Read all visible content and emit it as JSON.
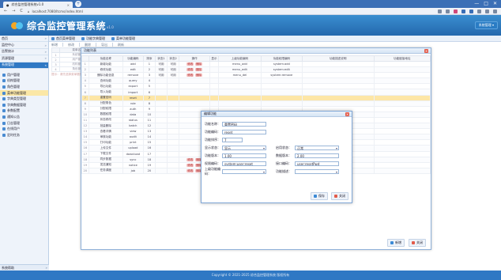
{
  "browser": {
    "tab_title": "综合监控管理系统v1.0",
    "url": "localhost:7080/ltcms/index.html",
    "buttons": [
      "←",
      "→",
      "C",
      "⌂"
    ],
    "window_controls": [
      "—",
      "□",
      "✕"
    ]
  },
  "header": {
    "app_title": "综合监控管理系统",
    "version": "v1.0",
    "user_button": "系统管理 ▾"
  },
  "sidebar": {
    "items": [
      {
        "label": "首页",
        "active": false
      },
      {
        "label": "监控中心",
        "active": false
      },
      {
        "label": "告警统计",
        "active": false
      },
      {
        "label": "资源管理",
        "active": false
      },
      {
        "label": "系统管理",
        "active": true
      }
    ],
    "subitems": [
      {
        "label": "用户管理",
        "selected": false
      },
      {
        "label": "机构管理",
        "selected": false
      },
      {
        "label": "角色管理",
        "selected": false
      },
      {
        "label": "菜单功能管理",
        "selected": true
      },
      {
        "label": "字典类型管理",
        "selected": false
      },
      {
        "label": "字典数据管理",
        "selected": false
      },
      {
        "label": "参数配置",
        "selected": false
      },
      {
        "label": "通知公告",
        "selected": false
      },
      {
        "label": "日志管理",
        "selected": false
      },
      {
        "label": "在线用户",
        "selected": false
      },
      {
        "label": "定时任务",
        "selected": false
      }
    ],
    "bottom_label": "系统帮助"
  },
  "breadcrumbs": [
    "首页菜单管理",
    "功能字典管理",
    "菜单功能管理"
  ],
  "toolbar": [
    "新增",
    "修改",
    "删除",
    "导出",
    "刷新"
  ],
  "bg_table": {
    "headers": [
      "",
      "菜单名称",
      "排序",
      "类型",
      "权限",
      "状态",
      "操作"
    ],
    "rows": [
      [
        "1",
        "系统管理",
        "1",
        "目录",
        "",
        "正常",
        "修改"
      ],
      [
        "2",
        "用户管理",
        "1",
        "菜单",
        "system:user",
        "正常",
        "修改"
      ],
      [
        "3",
        "机构管理",
        "2",
        "菜单",
        "system:dept",
        "正常",
        "修改"
      ],
      [
        "4",
        "角色管理",
        "3",
        "菜单",
        "system:role",
        "正常",
        "修改"
      ]
    ],
    "hint": "提示：请先选择菜单数据，再点击功能字典按钮进行操作"
  },
  "window": {
    "title": "功能列表",
    "headers": [
      "",
      "功能名称",
      "功能编码",
      "排序",
      "状态1",
      "状态2",
      "操作",
      "显示",
      "上级功能编码",
      "功能权限编码",
      "功能描述说明",
      "功能链接地址"
    ],
    "rows": [
      {
        "n": "1",
        "name": "新增功能",
        "code": "add",
        "sort": "1",
        "s1": "可用",
        "s2": "可用",
        "ops": [
          "修改",
          "删除"
        ],
        "pcode": "menu_add",
        "perm": "system:add",
        "hl": false
      },
      {
        "n": "2",
        "name": "修改功能",
        "code": "edit",
        "sort": "2",
        "s1": "可用",
        "s2": "可用",
        "ops": [
          "修改",
          "删除"
        ],
        "pcode": "menu_edit",
        "perm": "system:edit",
        "hl": false
      },
      {
        "n": "3",
        "name": "删除功能信息",
        "code": "remove",
        "sort": "3",
        "s1": "可用",
        "s2": "可用",
        "ops": [
          "修改",
          "删除"
        ],
        "pcode": "menu_del",
        "perm": "system:remove",
        "hl": false
      },
      {
        "n": "4",
        "name": "查询功能",
        "code": "query",
        "sort": "4",
        "s1": "",
        "s2": "",
        "ops": [],
        "pcode": "",
        "perm": "",
        "hl": false
      },
      {
        "n": "5",
        "name": "导出功能",
        "code": "export",
        "sort": "5",
        "s1": "",
        "s2": "",
        "ops": [],
        "pcode": "",
        "perm": "",
        "hl": false
      },
      {
        "n": "6",
        "name": "导入功能",
        "code": "import",
        "sort": "6",
        "s1": "",
        "s2": "",
        "ops": [],
        "pcode": "",
        "perm": "",
        "hl": false
      },
      {
        "n": "7",
        "name": "重置密码",
        "code": "reset",
        "sort": "7",
        "s1": "",
        "s2": "",
        "ops": [],
        "pcode": "",
        "perm": "",
        "hl": true
      },
      {
        "n": "8",
        "name": "分配角色",
        "code": "role",
        "sort": "8",
        "s1": "",
        "s2": "",
        "ops": [],
        "pcode": "",
        "perm": "",
        "hl": false
      },
      {
        "n": "9",
        "name": "分配权限",
        "code": "auth",
        "sort": "9",
        "s1": "",
        "s2": "",
        "ops": [],
        "pcode": "",
        "perm": "",
        "hl": false
      },
      {
        "n": "10",
        "name": "数据权限",
        "code": "data",
        "sort": "10",
        "s1": "",
        "s2": "",
        "ops": [],
        "pcode": "",
        "perm": "",
        "hl": false
      },
      {
        "n": "11",
        "name": "状态修改",
        "code": "status",
        "sort": "11",
        "s1": "",
        "s2": "",
        "ops": [],
        "pcode": "",
        "perm": "",
        "hl": false
      },
      {
        "n": "12",
        "name": "批量删除",
        "code": "batch",
        "sort": "12",
        "s1": "",
        "s2": "",
        "ops": [],
        "pcode": "",
        "perm": "",
        "hl": false
      },
      {
        "n": "13",
        "name": "查看详情",
        "code": "view",
        "sort": "13",
        "s1": "",
        "s2": "",
        "ops": [],
        "pcode": "",
        "perm": "",
        "hl": false
      },
      {
        "n": "14",
        "name": "审核功能",
        "code": "audit",
        "sort": "14",
        "s1": "",
        "s2": "",
        "ops": [],
        "pcode": "",
        "perm": "",
        "hl": false
      },
      {
        "n": "15",
        "name": "打印功能",
        "code": "print",
        "sort": "15",
        "s1": "",
        "s2": "",
        "ops": [],
        "pcode": "",
        "perm": "",
        "hl": false
      },
      {
        "n": "16",
        "name": "上传文件",
        "code": "upload",
        "sort": "16",
        "s1": "",
        "s2": "",
        "ops": [],
        "pcode": "",
        "perm": "",
        "hl": false
      },
      {
        "n": "17",
        "name": "下载文件",
        "code": "download",
        "sort": "17",
        "s1": "",
        "s2": "",
        "ops": [],
        "pcode": "",
        "perm": "",
        "hl": false
      },
      {
        "n": "18",
        "name": "同步数据",
        "code": "sync",
        "sort": "18",
        "s1": "",
        "s2": "",
        "ops": [
          "修改",
          "删除"
        ],
        "pcode": "",
        "perm": "",
        "hl": false
      },
      {
        "n": "19",
        "name": "发送通知",
        "code": "notice",
        "sort": "19",
        "s1": "",
        "s2": "",
        "ops": [
          "修改",
          "删除"
        ],
        "pcode": "",
        "perm": "",
        "hl": false
      },
      {
        "n": "20",
        "name": "任务调度",
        "code": "job",
        "sort": "20",
        "s1": "",
        "s2": "",
        "ops": [
          "修改",
          "删除"
        ],
        "pcode": "",
        "perm": "",
        "hl": false
      }
    ],
    "add_label": "新增",
    "close_label": "关闭"
  },
  "dialog": {
    "title": "编辑功能",
    "fields": {
      "name_label": "功能名称：",
      "name_value": "重置密码",
      "code_label": "功能编码：",
      "code_value": "reset",
      "sort_label": "功能排序：",
      "sort_value": "7",
      "status_label": "显示状态：",
      "status_value": "显示",
      "enable_label": "启用状态：",
      "enable_value": "正常",
      "ver1_label": "功能版本：",
      "ver1_value": "1.00",
      "ver2_label": "数据版本：",
      "ver2_value": "2.00",
      "perm_label": "权限编码：",
      "perm_value": "system:user:reset",
      "perm2_label": "接口编码：",
      "perm2_value": "user:resetPwd",
      "parent_label": "上级功能编码：",
      "parent_value": "",
      "desc_label": "功能描述：",
      "desc_value": ""
    },
    "save_label": "保存",
    "cancel_label": "关闭"
  },
  "footer": "Copyright © 2021-2025 综合监控管理系统 版权所有",
  "colors": {
    "primary": "#2f78c4",
    "highlight": "#fde6a6",
    "danger": "#e25b4a"
  }
}
